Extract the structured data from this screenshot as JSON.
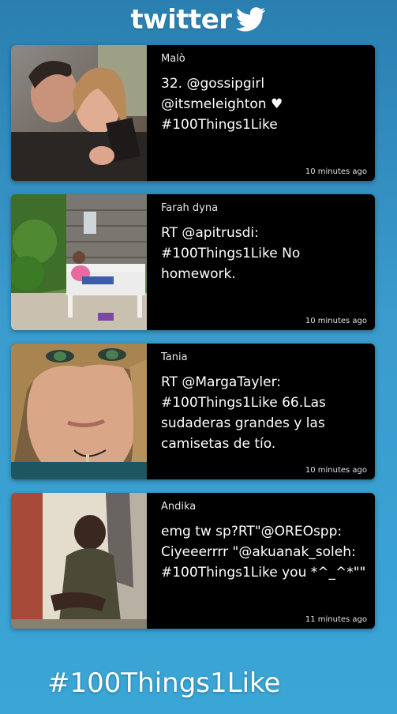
{
  "app": {
    "logo_text": "twitter",
    "logo_icon": "twitter-bird-icon",
    "brand_color": "#ffffff",
    "background_color": "#3399cc"
  },
  "tweets": [
    {
      "user": "Malò",
      "text": "32. @gossipgirl @itsmeleighton ♥ #100Things1Like",
      "time": "10 minutes ago"
    },
    {
      "user": "Farah dyna",
      "text": "RT @apitrusdi: #100Things1Like No homework.",
      "time": "10 minutes ago"
    },
    {
      "user": "Tania",
      "text": "RT @MargaTayler: #100Things1Like 66.Las sudaderas grandes y las camisetas de tío.",
      "time": "10 minutes ago"
    },
    {
      "user": "Andika",
      "text": "emg tw sp?RT\"@OREOspp: Ciyeeerrrr \"@akuanak_soleh: #100Things1Like you *^_^*\"\"",
      "time": "11 minutes ago"
    }
  ],
  "footer": {
    "hashtag": "#100Things1Like"
  }
}
